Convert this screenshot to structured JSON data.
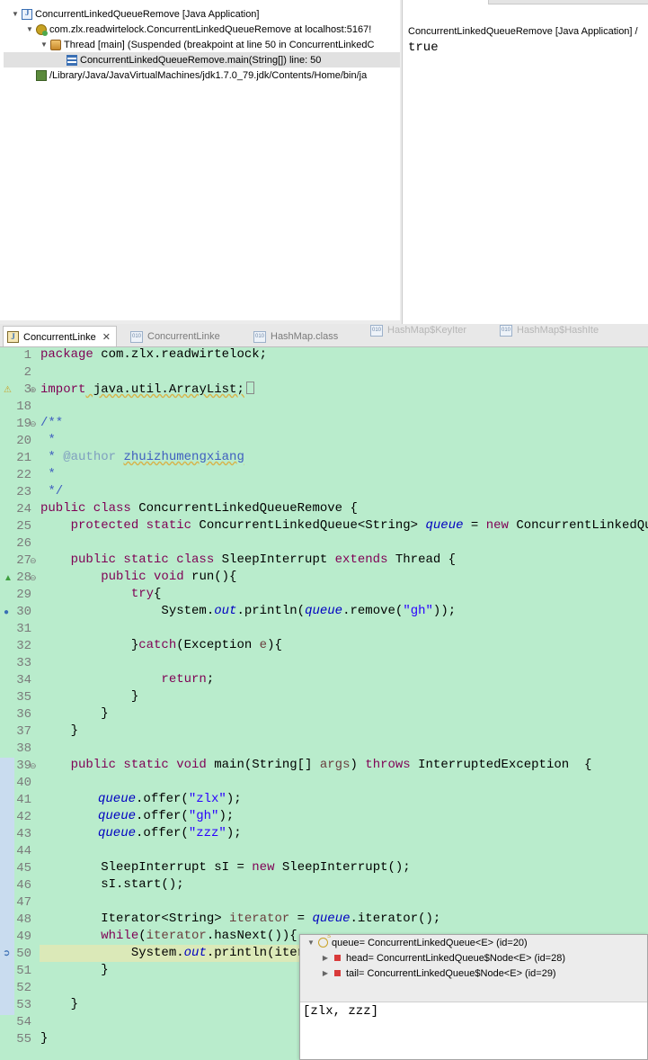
{
  "debug_tree": {
    "launch": "ConcurrentLinkedQueueRemove [Java Application]",
    "vm": "com.zlx.readwirtelock.ConcurrentLinkedQueueRemove at localhost:5167!",
    "thread": "Thread [main] (Suspended (breakpoint at line 50 in ConcurrentLinkedC",
    "frame": "ConcurrentLinkedQueueRemove.main(String[]) line: 50",
    "process": "/Library/Java/JavaVirtualMachines/jdk1.7.0_79.jdk/Contents/Home/bin/ja"
  },
  "console": {
    "header": "ConcurrentLinkedQueueRemove [Java Application] /",
    "output": "true"
  },
  "editor_tabs": [
    {
      "label": "ConcurrentLinke",
      "icon": "java-file-icon",
      "active": true
    },
    {
      "label": "ConcurrentLinke",
      "icon": "class-file-icon",
      "active": false
    },
    {
      "label": "HashMap.class",
      "icon": "class-file-icon",
      "active": false
    },
    {
      "label": "HashMap$KeyIter",
      "icon": "class-file-icon",
      "active": false
    },
    {
      "label": "HashMap$HashIte",
      "icon": "class-file-icon",
      "active": false
    }
  ],
  "line_numbers": [
    "1",
    "2",
    "3",
    "18",
    "19",
    "20",
    "21",
    "22",
    "23",
    "24",
    "25",
    "26",
    "27",
    "28",
    "29",
    "30",
    "31",
    "32",
    "33",
    "34",
    "35",
    "36",
    "37",
    "38",
    "39",
    "40",
    "41",
    "42",
    "43",
    "44",
    "45",
    "46",
    "47",
    "48",
    "49",
    "50",
    "51",
    "52",
    "53",
    "54",
    "55"
  ],
  "code": {
    "l1_package": "package",
    "l1_name": " com.zlx.readwirtelock;",
    "l3_import": "import",
    "l3_name": " java.util.ArrayList;",
    "l19": "/**",
    "l20": " *",
    "l21_star": " * ",
    "l21_tag": "@author",
    "l21_name": "zhuizhumengxiang",
    "l22": " *",
    "l23": " */",
    "l24_kw": "public class",
    "l24_rest": " ConcurrentLinkedQueueRemove {",
    "l25_kw": "    protected static",
    "l25_type": " ConcurrentLinkedQueue<String> ",
    "l25_field": "queue",
    "l25_eq": " = ",
    "l25_new": "new",
    "l25_rest": " ConcurrentLinkedQueue<",
    "l27_kw": "    public static class",
    "l27_name": " SleepInterrupt ",
    "l27_ext": "extends",
    "l27_rest": " Thread {",
    "l28_kw": "        public void",
    "l28_rest": " run(){",
    "l29_kw": "            try",
    "l29_rest": "{",
    "l30_a": "                System.",
    "l30_out": "out",
    "l30_b": ".println(",
    "l30_q": "queue",
    "l30_c": ".remove(",
    "l30_s": "\"gh\"",
    "l30_d": "));",
    "l32_a": "            }",
    "l32_kw": "catch",
    "l32_b": "(Exception ",
    "l32_p": "e",
    "l32_c": "){",
    "l34_kw": "                return",
    "l34_rest": ";",
    "l35": "            }",
    "l36": "        }",
    "l37": "    }",
    "l39_kw": "    public static void",
    "l39_a": " main(String[] ",
    "l39_p": "args",
    "l39_b": ") ",
    "l39_throws": "throws",
    "l39_c": " InterruptedException  {",
    "l41_q": "queue",
    "l41_a": ".offer(",
    "l41_s": "\"zlx\"",
    "l41_b": ");",
    "l42_q": "queue",
    "l42_a": ".offer(",
    "l42_s": "\"gh\"",
    "l42_b": ");",
    "l43_q": "queue",
    "l43_a": ".offer(",
    "l43_s": "\"zzz\"",
    "l43_b": ");",
    "l45_a": "        SleepInterrupt ",
    "l45_v": "sI",
    "l45_b": " = ",
    "l45_new": "new",
    "l45_c": " SleepInterrupt();",
    "l46_v": "        sI",
    "l46_rest": ".start();",
    "l48_a": "        Iterator<String> ",
    "l48_v": "iterator",
    "l48_b": " = ",
    "l48_q": "queue",
    "l48_c": ".iterator();",
    "l49_kw": "        while",
    "l49_a": "(",
    "l49_v": "iterator",
    "l49_b": ".hasNext()){",
    "l50_a": "            System.",
    "l50_out": "out",
    "l50_b": ".println(itera",
    "l51": "        }",
    "l53": "    }",
    "l55": "}"
  },
  "inspector": {
    "root": "queue= ConcurrentLinkedQueue<E>  (id=20)",
    "head": "head= ConcurrentLinkedQueue$Node<E>  (id=28)",
    "tail": "tail= ConcurrentLinkedQueue$Node<E>  (id=29)",
    "detail": "[zlx, zzz]"
  }
}
